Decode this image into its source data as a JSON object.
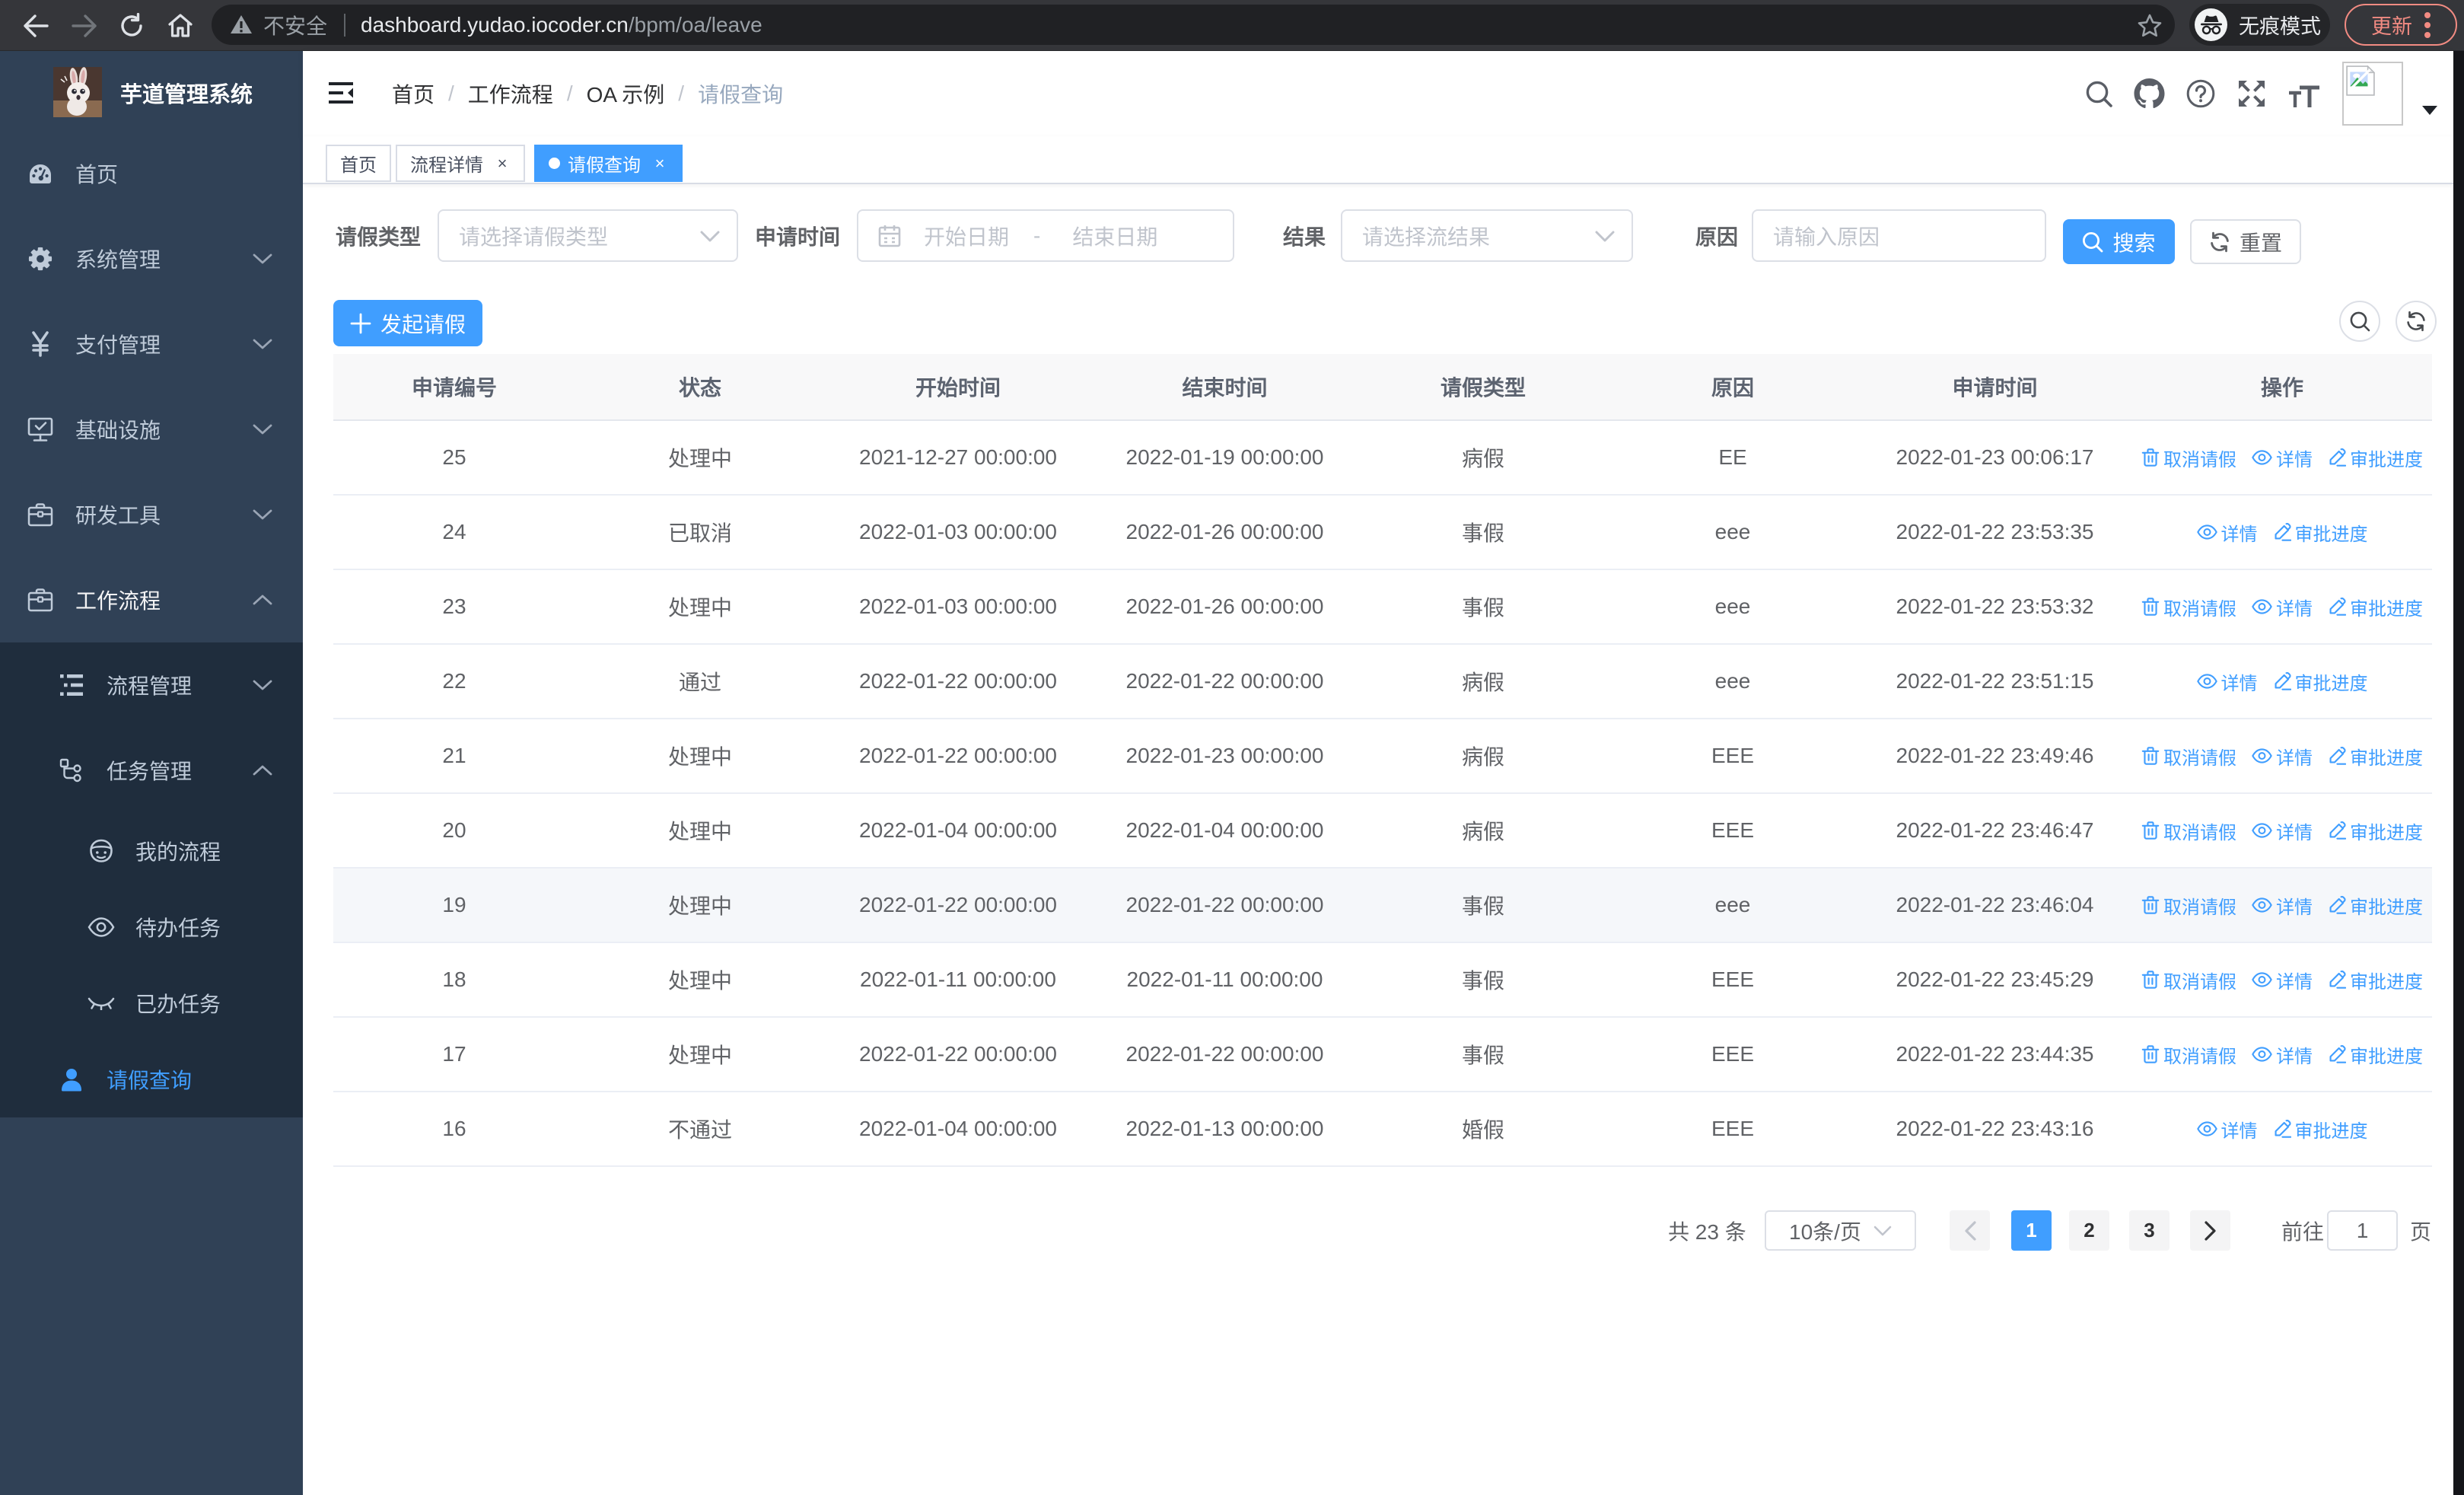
{
  "colors": {
    "accent": "#409eff",
    "sidebar_bg": "#304156",
    "submenu_bg": "#1f2d3d",
    "menu_text": "#bfcbd9",
    "update": "#f28b82"
  },
  "browser": {
    "security_label": "不安全",
    "url_host": "dashboard.yudao.iocoder.cn",
    "url_path": "/bpm/oa/leave",
    "incognito_label": "无痕模式",
    "update_label": "更新"
  },
  "sidebar": {
    "logo_title": "芋道管理系统",
    "menu": [
      {
        "label": "首页",
        "icon": "dashboard",
        "level": 1,
        "arrow": ""
      },
      {
        "label": "系统管理",
        "icon": "gear",
        "level": 1,
        "arrow": "down"
      },
      {
        "label": "支付管理",
        "icon": "yen",
        "level": 1,
        "arrow": "down"
      },
      {
        "label": "基础设施",
        "icon": "monitor",
        "level": 1,
        "arrow": "down"
      },
      {
        "label": "研发工具",
        "icon": "briefcase",
        "level": 1,
        "arrow": "down"
      },
      {
        "label": "工作流程",
        "icon": "briefcase",
        "level": 1,
        "arrow": "up",
        "opened": true
      },
      {
        "label": "流程管理",
        "icon": "tree-table",
        "level": 2,
        "arrow": "down"
      },
      {
        "label": "任务管理",
        "icon": "tree",
        "level": 2,
        "arrow": "up"
      },
      {
        "label": "我的流程",
        "icon": "face",
        "level": 3,
        "arrow": ""
      },
      {
        "label": "待办任务",
        "icon": "eye-open",
        "level": 3,
        "arrow": ""
      },
      {
        "label": "已办任务",
        "icon": "eye-close",
        "level": 3,
        "arrow": ""
      },
      {
        "label": "请假查询",
        "icon": "user",
        "level": 2,
        "arrow": "",
        "active": true,
        "short": true
      }
    ]
  },
  "breadcrumb": [
    "首页",
    "工作流程",
    "OA 示例",
    "请假查询"
  ],
  "tabs": [
    {
      "label": "首页",
      "closable": false,
      "active": false
    },
    {
      "label": "流程详情",
      "closable": true,
      "active": false
    },
    {
      "label": "请假查询",
      "closable": true,
      "active": true
    }
  ],
  "filter": {
    "type_label": "请假类型",
    "type_placeholder": "请选择请假类型",
    "time_label": "申请时间",
    "start_placeholder": "开始日期",
    "range_separator": "-",
    "end_placeholder": "结束日期",
    "result_label": "结果",
    "result_placeholder": "请选择流结果",
    "reason_label": "原因",
    "reason_placeholder": "请输入原因",
    "search_label": "搜索",
    "reset_label": "重置"
  },
  "toolbar": {
    "create_label": "发起请假"
  },
  "table": {
    "columns": [
      "申请编号",
      "状态",
      "开始时间",
      "结束时间",
      "请假类型",
      "原因",
      "申请时间",
      "操作"
    ],
    "action_labels": {
      "cancel": "取消请假",
      "detail": "详情",
      "progress": "审批进度"
    },
    "rows": [
      {
        "id": "25",
        "status": "处理中",
        "start": "2021-12-27 00:00:00",
        "end": "2022-01-19 00:00:00",
        "type": "病假",
        "reason": "EE",
        "apply": "2022-01-23 00:06:17",
        "cancellable": true,
        "hover": false
      },
      {
        "id": "24",
        "status": "已取消",
        "start": "2022-01-03 00:00:00",
        "end": "2022-01-26 00:00:00",
        "type": "事假",
        "reason": "eee",
        "apply": "2022-01-22 23:53:35",
        "cancellable": false,
        "hover": false
      },
      {
        "id": "23",
        "status": "处理中",
        "start": "2022-01-03 00:00:00",
        "end": "2022-01-26 00:00:00",
        "type": "事假",
        "reason": "eee",
        "apply": "2022-01-22 23:53:32",
        "cancellable": true,
        "hover": false
      },
      {
        "id": "22",
        "status": "通过",
        "start": "2022-01-22 00:00:00",
        "end": "2022-01-22 00:00:00",
        "type": "病假",
        "reason": "eee",
        "apply": "2022-01-22 23:51:15",
        "cancellable": false,
        "hover": false
      },
      {
        "id": "21",
        "status": "处理中",
        "start": "2022-01-22 00:00:00",
        "end": "2022-01-23 00:00:00",
        "type": "病假",
        "reason": "EEE",
        "apply": "2022-01-22 23:49:46",
        "cancellable": true,
        "hover": false
      },
      {
        "id": "20",
        "status": "处理中",
        "start": "2022-01-04 00:00:00",
        "end": "2022-01-04 00:00:00",
        "type": "病假",
        "reason": "EEE",
        "apply": "2022-01-22 23:46:47",
        "cancellable": true,
        "hover": false
      },
      {
        "id": "19",
        "status": "处理中",
        "start": "2022-01-22 00:00:00",
        "end": "2022-01-22 00:00:00",
        "type": "事假",
        "reason": "eee",
        "apply": "2022-01-22 23:46:04",
        "cancellable": true,
        "hover": true
      },
      {
        "id": "18",
        "status": "处理中",
        "start": "2022-01-11 00:00:00",
        "end": "2022-01-11 00:00:00",
        "type": "事假",
        "reason": "EEE",
        "apply": "2022-01-22 23:45:29",
        "cancellable": true,
        "hover": false
      },
      {
        "id": "17",
        "status": "处理中",
        "start": "2022-01-22 00:00:00",
        "end": "2022-01-22 00:00:00",
        "type": "事假",
        "reason": "EEE",
        "apply": "2022-01-22 23:44:35",
        "cancellable": true,
        "hover": false
      },
      {
        "id": "16",
        "status": "不通过",
        "start": "2022-01-04 00:00:00",
        "end": "2022-01-13 00:00:00",
        "type": "婚假",
        "reason": "EEE",
        "apply": "2022-01-22 23:43:16",
        "cancellable": false,
        "hover": false
      }
    ]
  },
  "pagination": {
    "total_label": "共 23 条",
    "page_size": "10条/页",
    "pages": [
      "1",
      "2",
      "3"
    ],
    "active_page": "1",
    "goto_label": "前往",
    "goto_value": "1",
    "page_label": "页"
  }
}
